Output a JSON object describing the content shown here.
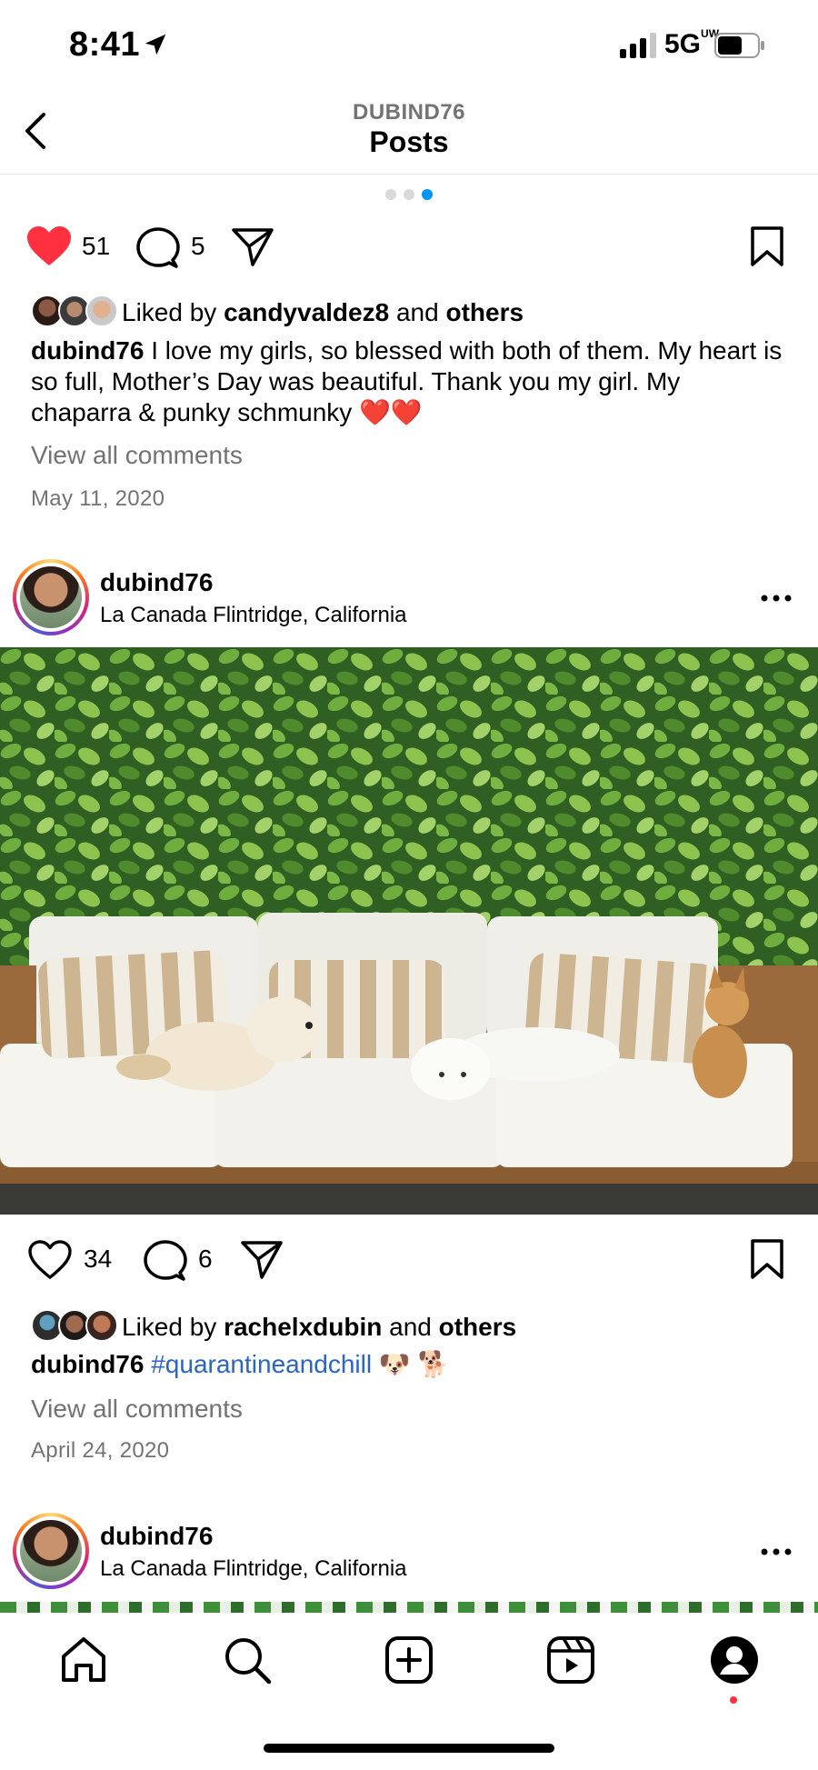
{
  "status_bar": {
    "time": "8:41",
    "network": "5G",
    "network_suffix": "UW"
  },
  "header": {
    "account": "DUBIND76",
    "title": "Posts"
  },
  "carousel": {
    "count": 3,
    "active_index": 2
  },
  "post1": {
    "likes": "51",
    "comments": "5",
    "liked": true,
    "liked_by_prefix": "Liked by",
    "liked_by_user": "candyvaldez8",
    "liked_by_and": "and",
    "liked_by_others": "others",
    "caption_user": "dubind76",
    "caption_text": "I love my girls, so blessed with both of them. My heart is so full, Mother’s Day was beautiful. Thank you my girl. My chaparra & punky schmunky ❤️❤️",
    "view_all": "View all comments",
    "date": "May 11, 2020"
  },
  "post2": {
    "username": "dubind76",
    "location": "La Canada Flintridge, California",
    "likes": "34",
    "comments": "6",
    "liked": false,
    "liked_by_prefix": "Liked by",
    "liked_by_user": "rachelxdubin",
    "liked_by_and": "and",
    "liked_by_others": "others",
    "caption_user": "dubind76",
    "caption_tag": "#quarantineandchill",
    "caption_emoji": "🐶 🐕",
    "view_all": "View all comments",
    "date": "April 24, 2020"
  },
  "post3": {
    "username": "dubind76",
    "location": "La Canada Flintridge, California"
  },
  "nav": {
    "items": [
      "home-icon",
      "search-icon",
      "create-icon",
      "reels-icon",
      "profile-icon"
    ]
  },
  "colors": {
    "like_red": "#ff3040",
    "link_blue": "#2a64c5",
    "carousel_active": "#0095f6"
  }
}
